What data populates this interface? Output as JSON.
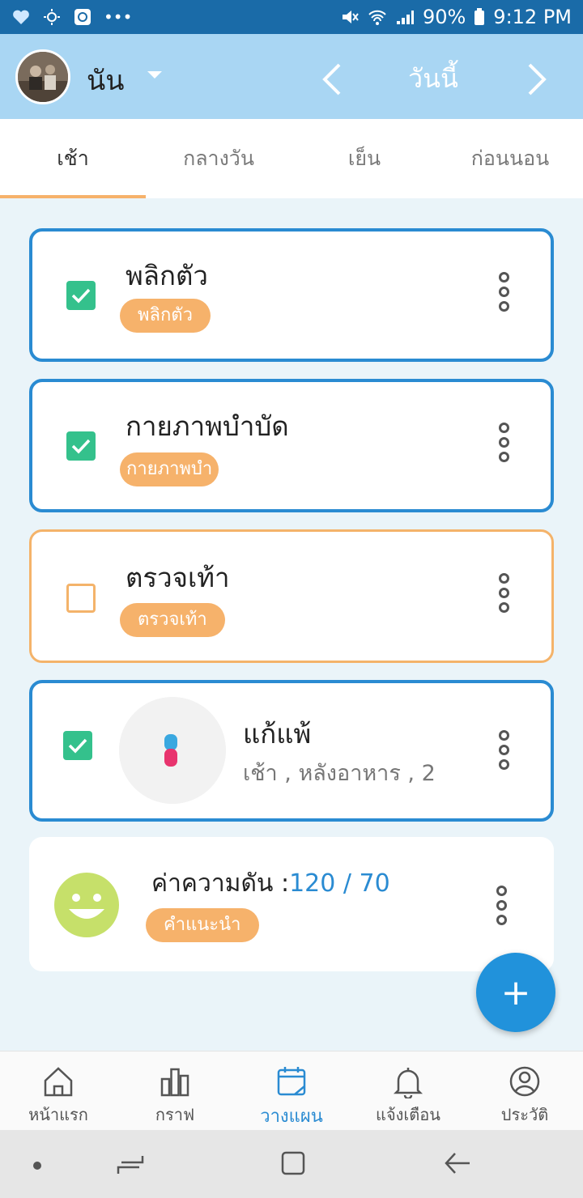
{
  "status_bar": {
    "battery": "90%",
    "time": "9:12 PM",
    "overflow": "•••"
  },
  "header": {
    "user_name": "นัน",
    "date_label": "วันนี้"
  },
  "tabs": [
    {
      "label": "เช้า",
      "active": true
    },
    {
      "label": "กลางวัน",
      "active": false
    },
    {
      "label": "เย็น",
      "active": false
    },
    {
      "label": "ก่อนนอน",
      "active": false
    }
  ],
  "cards": [
    {
      "title": "พลิกตัว",
      "tag": "พลิกตัว",
      "checked": true
    },
    {
      "title": "กายภาพบำบัด",
      "tag": "กายภาพบำ",
      "checked": true
    },
    {
      "title": "ตรวจเท้า",
      "tag": "ตรวจเท้า",
      "checked": false
    },
    {
      "title": "แก้แพ้",
      "subtitle": "เช้า , หลังอาหาร , 2",
      "checked": true
    },
    {
      "title_prefix": "ค่าความดัน :",
      "value": "120 / 70",
      "tag": "คำแนะนำ"
    }
  ],
  "fab": {
    "label": "+"
  },
  "bottom_nav": [
    {
      "label": "หน้าแรก",
      "icon": "home-icon"
    },
    {
      "label": "กราฟ",
      "icon": "chart-icon"
    },
    {
      "label": "วางแผน",
      "icon": "calendar-icon",
      "active": true
    },
    {
      "label": "แจ้งเตือน",
      "icon": "bell-icon"
    },
    {
      "label": "ประวัติ",
      "icon": "profile-icon"
    }
  ],
  "colors": {
    "header_bg": "#a9d6f3",
    "status_bg": "#1a6ba8",
    "accent_blue": "#2a8bd2",
    "accent_orange": "#f6b26b",
    "check_green": "#34c18c"
  }
}
